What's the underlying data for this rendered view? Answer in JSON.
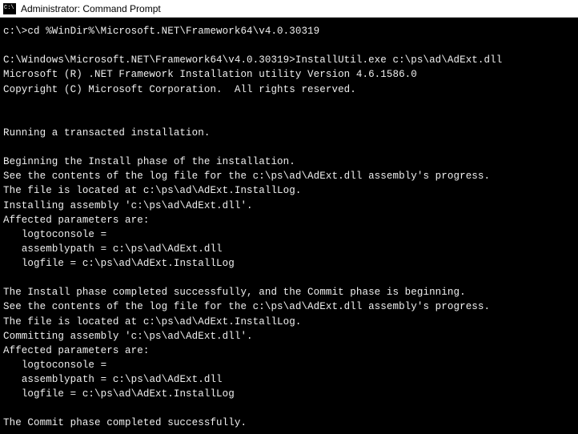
{
  "titlebar": {
    "title": "Administrator: Command Prompt"
  },
  "terminal": {
    "lines": [
      "c:\\>cd %WinDir%\\Microsoft.NET\\Framework64\\v4.0.30319",
      "",
      "C:\\Windows\\Microsoft.NET\\Framework64\\v4.0.30319>InstallUtil.exe c:\\ps\\ad\\AdExt.dll",
      "Microsoft (R) .NET Framework Installation utility Version 4.6.1586.0",
      "Copyright (C) Microsoft Corporation.  All rights reserved.",
      "",
      "",
      "Running a transacted installation.",
      "",
      "Beginning the Install phase of the installation.",
      "See the contents of the log file for the c:\\ps\\ad\\AdExt.dll assembly's progress.",
      "The file is located at c:\\ps\\ad\\AdExt.InstallLog.",
      "Installing assembly 'c:\\ps\\ad\\AdExt.dll'.",
      "Affected parameters are:",
      "   logtoconsole =",
      "   assemblypath = c:\\ps\\ad\\AdExt.dll",
      "   logfile = c:\\ps\\ad\\AdExt.InstallLog",
      "",
      "The Install phase completed successfully, and the Commit phase is beginning.",
      "See the contents of the log file for the c:\\ps\\ad\\AdExt.dll assembly's progress.",
      "The file is located at c:\\ps\\ad\\AdExt.InstallLog.",
      "Committing assembly 'c:\\ps\\ad\\AdExt.dll'.",
      "Affected parameters are:",
      "   logtoconsole =",
      "   assemblypath = c:\\ps\\ad\\AdExt.dll",
      "   logfile = c:\\ps\\ad\\AdExt.InstallLog",
      "",
      "The Commit phase completed successfully."
    ]
  }
}
